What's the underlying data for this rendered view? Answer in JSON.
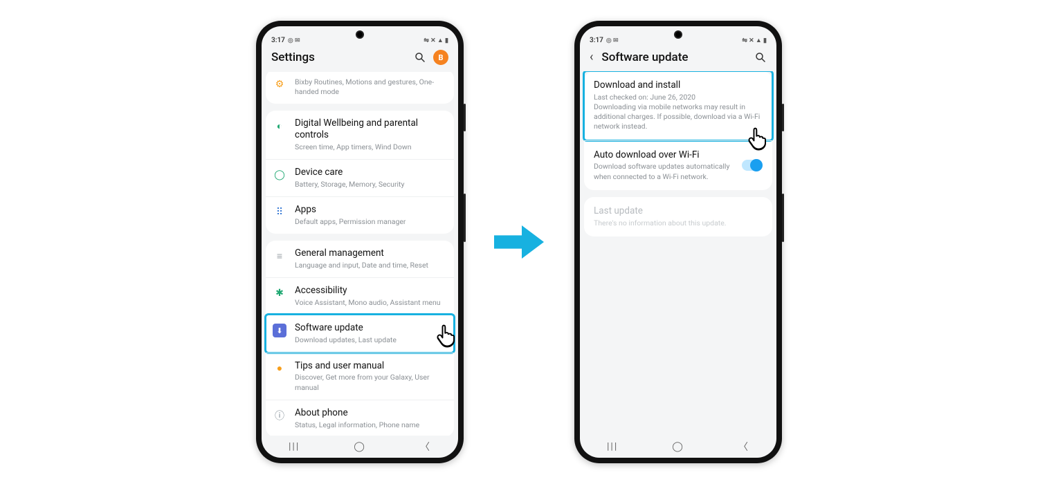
{
  "status": {
    "time": "3:17",
    "left_icons": "◎ ✉",
    "right_icons": "⇋ ✕ ▲ ▮"
  },
  "phone1": {
    "header": {
      "title": "Settings",
      "avatar_letter": "B"
    },
    "top_row": {
      "sub": "Bixby Routines, Motions and gestures, One-handed mode"
    },
    "group1": [
      {
        "title": "Digital Wellbeing and parental controls",
        "sub": "Screen time, App timers, Wind Down",
        "icon_color": "#1fa872",
        "icon": "◐"
      },
      {
        "title": "Device care",
        "sub": "Battery, Storage, Memory, Security",
        "icon_color": "#1fa872",
        "icon": "◯"
      },
      {
        "title": "Apps",
        "sub": "Default apps, Permission manager",
        "icon_color": "#3a7bd5",
        "icon": "⠿"
      }
    ],
    "group2": [
      {
        "title": "General management",
        "sub": "Language and input, Date and time, Reset",
        "icon_color": "#f79e1b",
        "icon": "≡"
      },
      {
        "title": "Accessibility",
        "sub": "Voice Assistant, Mono audio, Assistant menu",
        "icon_color": "#1fa872",
        "icon": "✱"
      },
      {
        "title": "Software update",
        "sub": "Download updates, Last update",
        "icon_color": "#5b6fd8",
        "icon": "⬇"
      },
      {
        "title": "Tips and user manual",
        "sub": "Discover, Get more from your Galaxy, User manual",
        "icon_color": "#f79e1b",
        "icon": "●"
      },
      {
        "title": "About phone",
        "sub": "Status, Legal information, Phone name",
        "icon_color": "#7e8a93",
        "icon": "ⓘ"
      }
    ]
  },
  "phone2": {
    "header": {
      "title": "Software update"
    },
    "items": {
      "download": {
        "title": "Download and install",
        "sub": "Last checked on: June 26, 2020\nDownloading via mobile networks may result in additional charges. If possible, download via a Wi-Fi network instead."
      },
      "auto": {
        "title": "Auto download over Wi-Fi",
        "sub": "Download software updates automatically when connected to a Wi-Fi network."
      },
      "last": {
        "title": "Last update",
        "sub": "There's no information about this update."
      }
    }
  }
}
